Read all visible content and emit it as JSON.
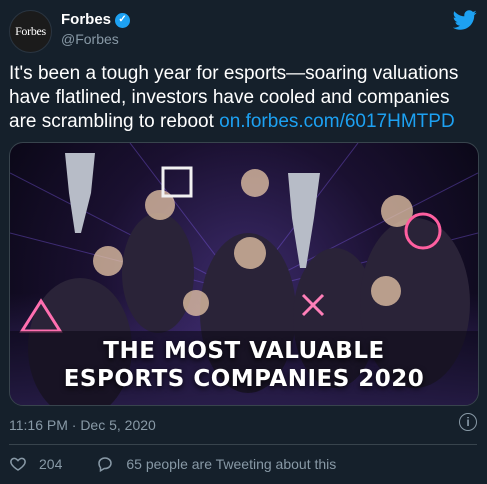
{
  "author": {
    "avatar_text": "Forbes",
    "display_name": "Forbes",
    "handle": "@Forbes"
  },
  "tweet": {
    "text": "It's been a tough year for esports—soaring valuations have flatlined, investors have cooled and companies are scrambling to reboot ",
    "link": "on.forbes.com/6017HMTPD"
  },
  "media": {
    "banner_line1": "THE MOST VALUABLE",
    "banner_line2": "ESPORTS COMPANIES 2020"
  },
  "timestamp": "11:16 PM · Dec 5, 2020",
  "actions": {
    "likes": "204",
    "conversation": "65 people are Tweeting about this"
  },
  "colors": {
    "background": "#15202b",
    "accent": "#1da1f2",
    "muted": "#8899a6"
  }
}
